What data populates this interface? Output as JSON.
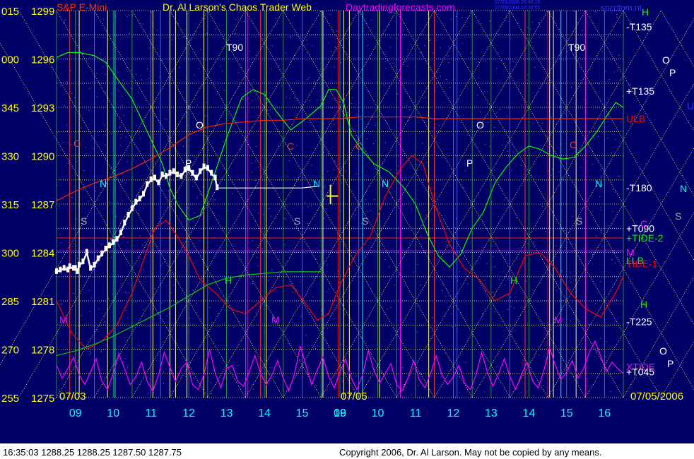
{
  "header": {
    "symbol": "S&P E-Mini",
    "title": "Dr. Al Larson's Chaos Trader Web",
    "site": "Daytradingforecasts.com",
    "stamp1": "07/03/2006 20:40:15",
    "stamp2": "07/05/2006 15:30:05",
    "tag": "spcctom.nt"
  },
  "footer": {
    "quote": "16:35:03  1288.25 1288.25 1287.50 1287.75",
    "copyright": "Copyright 2006, Dr. Al Larson. May not be copied by any means."
  },
  "colors": {
    "background": "#000066",
    "price": "#ffffff",
    "green_line": "#00ff00",
    "red_line": "#ff0000",
    "magenta_line": "#ff00ff",
    "tide_line": "#ff3300",
    "grid": "#ffff66",
    "title": "#ffff00",
    "site": "#ff00ff"
  },
  "chart_data": {
    "type": "line",
    "title": "S&P E-Mini",
    "xlabel": "",
    "ylabel": "",
    "ylim": [
      1275,
      1299
    ],
    "y_ticks": [
      {
        "value": 1299,
        "label": "1299",
        "angle": "015"
      },
      {
        "value": 1296,
        "label": "1296",
        "angle": "000"
      },
      {
        "value": 1293,
        "label": "1293",
        "angle": "345"
      },
      {
        "value": 1290,
        "label": "1290",
        "angle": "330"
      },
      {
        "value": 1287,
        "label": "1287",
        "angle": "315"
      },
      {
        "value": 1284,
        "label": "1284",
        "angle": "300"
      },
      {
        "value": 1281,
        "label": "1281",
        "angle": "285"
      },
      {
        "value": 1278,
        "label": "1278",
        "angle": "270"
      },
      {
        "value": 1275,
        "label": "1275",
        "angle": "255"
      }
    ],
    "x_ticks": [
      "09",
      "10",
      "11",
      "12",
      "13",
      "14",
      "15",
      "16",
      "09",
      "10",
      "11",
      "12",
      "13",
      "14",
      "15",
      "16"
    ],
    "date_labels": [
      "07/03",
      "07/05",
      "07/05/2006"
    ],
    "right_labels": [
      {
        "text": "-T135",
        "value": 1298.0,
        "color": "#ffffff"
      },
      {
        "text": "+T135",
        "value": 1294.0,
        "color": "#ffffff"
      },
      {
        "text": "ULB",
        "value": 1292.3,
        "color": "#ff0000"
      },
      {
        "text": "-T180",
        "value": 1288.0,
        "color": "#ffffff"
      },
      {
        "text": "+T090",
        "value": 1285.5,
        "color": "#ffffff"
      },
      {
        "text": "+TIDE-2",
        "value": 1284.9,
        "color": "#00ff00"
      },
      {
        "text": "M",
        "value": 1284.0,
        "color": "#ff00ff"
      },
      {
        "text": "LLB",
        "value": 1283.5,
        "color": "#00ff00"
      },
      {
        "text": "TIDE-1",
        "value": 1283.3,
        "color": "#ff0000"
      },
      {
        "text": "-T225",
        "value": 1279.7,
        "color": "#ffffff"
      },
      {
        "text": "XTIDE",
        "value": 1276.9,
        "color": "#ff00ff"
      },
      {
        "text": "+T045",
        "value": 1276.6,
        "color": "#ffffff"
      }
    ],
    "planet_labels": [
      {
        "text": "H",
        "x": 908,
        "y": 22,
        "color": "#00ff00"
      },
      {
        "text": "O",
        "x": 937,
        "y": 90,
        "color": "#ffffff"
      },
      {
        "text": "P",
        "x": 947,
        "y": 108,
        "color": "#ffffff"
      },
      {
        "text": "U",
        "x": 972,
        "y": 155,
        "color": "#3333ff"
      },
      {
        "text": "N",
        "x": 962,
        "y": 272,
        "color": "#00ffff"
      },
      {
        "text": "S",
        "x": 955,
        "y": 311,
        "color": "#aaaaaa"
      },
      {
        "text": "C",
        "x": 906,
        "y": 322,
        "color": "#ff00ff"
      },
      {
        "text": "H",
        "x": 906,
        "y": 436,
        "color": "#00ff00"
      },
      {
        "text": "O",
        "x": 933,
        "y": 502,
        "color": "#ffffff"
      },
      {
        "text": "P",
        "x": 944,
        "y": 520,
        "color": "#ffffff"
      },
      {
        "text": "T90",
        "x": 320,
        "y": 72,
        "color": "#ffffff"
      },
      {
        "text": "T90",
        "x": 804,
        "y": 72,
        "color": "#ffffff"
      },
      {
        "text": "O",
        "x": 277,
        "y": 182,
        "color": "#ffffff"
      },
      {
        "text": "O",
        "x": 674,
        "y": 182,
        "color": "#ffffff"
      },
      {
        "text": "P",
        "x": 262,
        "y": 236,
        "color": "#ffffff"
      },
      {
        "text": "P",
        "x": 660,
        "y": 236,
        "color": "#ffffff"
      },
      {
        "text": "N",
        "x": 141,
        "y": 265,
        "color": "#00ffff"
      },
      {
        "text": "N",
        "x": 443,
        "y": 265,
        "color": "#00ffff"
      },
      {
        "text": "N",
        "x": 540,
        "y": 265,
        "color": "#00ffff"
      },
      {
        "text": "N",
        "x": 842,
        "y": 265,
        "color": "#00ffff"
      },
      {
        "text": "C",
        "x": 104,
        "y": 208,
        "color": "#ff3300"
      },
      {
        "text": "C",
        "x": 406,
        "y": 212,
        "color": "#ff3300"
      },
      {
        "text": "C",
        "x": 503,
        "y": 212,
        "color": "#ff3300"
      },
      {
        "text": "C",
        "x": 806,
        "y": 210,
        "color": "#ff3300"
      },
      {
        "text": "H",
        "x": 318,
        "y": 402,
        "color": "#00ff00"
      },
      {
        "text": "H",
        "x": 722,
        "y": 402,
        "color": "#00ff00"
      },
      {
        "text": "M",
        "x": 384,
        "y": 458,
        "color": "#ff00ff"
      },
      {
        "text": "M",
        "x": 784,
        "y": 458,
        "color": "#ff00ff"
      },
      {
        "text": "M",
        "x": 84,
        "y": 458,
        "color": "#ff00ff"
      },
      {
        "text": "S",
        "x": 114,
        "y": 318,
        "color": "#aaaaaa"
      },
      {
        "text": "S",
        "x": 416,
        "y": 318,
        "color": "#aaaaaa"
      },
      {
        "text": "S",
        "x": 512,
        "y": 318,
        "color": "#aaaaaa"
      },
      {
        "text": "S",
        "x": 815,
        "y": 318,
        "color": "#aaaaaa"
      }
    ],
    "series": [
      {
        "name": "S&P E-Mini",
        "color": "#ffffff",
        "x": [
          0.0,
          0.1,
          0.2,
          0.3,
          0.35,
          0.45,
          0.5,
          0.55,
          0.6,
          0.7,
          0.8,
          0.9,
          1.0,
          1.1,
          1.2,
          1.3,
          1.4,
          1.5,
          1.6,
          1.7,
          1.8,
          1.9,
          2.0,
          2.1,
          2.2,
          2.3,
          2.4,
          2.5,
          2.6,
          2.7,
          2.8,
          2.9,
          3.0,
          3.1,
          3.2,
          3.3,
          3.4,
          3.5,
          3.6,
          3.7,
          3.8,
          3.9,
          4.0,
          4.1,
          4.2,
          4.25
        ],
        "values": [
          1282.8,
          1282.9,
          1283.0,
          1282.9,
          1283.1,
          1283.0,
          1283.0,
          1282.8,
          1283.2,
          1283.4,
          1284.0,
          1283.0,
          1283.2,
          1283.6,
          1283.9,
          1284.2,
          1284.4,
          1284.6,
          1284.8,
          1285.2,
          1285.8,
          1286.3,
          1286.7,
          1287.1,
          1287.3,
          1287.6,
          1288.2,
          1288.5,
          1288.6,
          1288.3,
          1288.8,
          1288.7,
          1288.9,
          1289.0,
          1288.8,
          1288.7,
          1289.1,
          1289.2,
          1288.9,
          1288.6,
          1289.0,
          1289.3,
          1289.2,
          1288.9,
          1288.6,
          1288.0
        ]
      },
      {
        "name": "Flat",
        "color": "#ffffff",
        "x": [
          4.25,
          4.5,
          5.0,
          5.5,
          6.0,
          6.5,
          6.9
        ],
        "values": [
          1288.0,
          1288.0,
          1288.0,
          1288.0,
          1288.0,
          1288.0,
          1288.1
        ]
      },
      {
        "name": "Green",
        "color": "#00ff00",
        "x": [
          0,
          0.3,
          0.6,
          1.0,
          1.3,
          1.6,
          2.0,
          2.4,
          2.8,
          3.0,
          3.2,
          3.5,
          3.8,
          4.1,
          4.5,
          4.9,
          5.2,
          5.5,
          5.8,
          6.2,
          6.6,
          7.0,
          7.2,
          7.4,
          7.6,
          7.8,
          8.1,
          8.4,
          8.8,
          9.2,
          9.5,
          9.8,
          10.1,
          10.4,
          10.7,
          11.0,
          11.3,
          11.6,
          11.9,
          12.2,
          12.5,
          12.8,
          13.1,
          13.4,
          13.7,
          14.0,
          14.3,
          14.6,
          14.8,
          15.0
        ],
        "values": [
          1296.1,
          1296.4,
          1296.4,
          1296.2,
          1295.8,
          1294.8,
          1293.5,
          1291.5,
          1289.5,
          1288.0,
          1287.0,
          1286.0,
          1286.3,
          1288.3,
          1291.1,
          1293.6,
          1294.1,
          1293.8,
          1292.8,
          1291.6,
          1292.3,
          1293.1,
          1294.1,
          1294.1,
          1293.3,
          1291.3,
          1290.3,
          1289.5,
          1289.0,
          1288.0,
          1287.0,
          1285.2,
          1283.8,
          1283.1,
          1283.9,
          1285.5,
          1286.5,
          1288.3,
          1289.3,
          1290.1,
          1290.6,
          1290.4,
          1290.0,
          1289.8,
          1289.9,
          1290.6,
          1291.5,
          1292.6,
          1293.3,
          1293.0
        ]
      },
      {
        "name": "Red",
        "color": "#ff0000",
        "x": [
          0,
          0.4,
          0.8,
          1.2,
          1.6,
          2.0,
          2.3,
          2.6,
          2.9,
          3.2,
          3.5,
          3.8,
          4.2,
          4.6,
          5.0,
          5.4,
          5.8,
          6.2,
          6.6,
          6.9,
          7.2,
          7.5,
          7.9,
          8.3,
          8.7,
          9.1,
          9.4,
          9.7,
          10.0,
          10.4,
          10.8,
          11.2,
          11.6,
          12.0,
          12.4,
          12.8,
          13.2,
          13.6,
          14.0,
          14.4,
          14.8,
          15.0
        ],
        "values": [
          1281.0,
          1279.0,
          1278.0,
          1278.5,
          1279.5,
          1281.5,
          1283.5,
          1285.5,
          1286.0,
          1285.0,
          1283.8,
          1282.3,
          1281.5,
          1280.5,
          1280.2,
          1281.0,
          1281.8,
          1282.0,
          1280.8,
          1279.8,
          1280.2,
          1282.0,
          1283.8,
          1285.0,
          1287.5,
          1289.2,
          1290.0,
          1289.5,
          1287.0,
          1284.5,
          1283.0,
          1282.3,
          1281.0,
          1281.5,
          1283.8,
          1284.0,
          1283.0,
          1281.5,
          1280.5,
          1280.0,
          1281.5,
          1282.5
        ]
      },
      {
        "name": "ULB",
        "color": "#ff2200",
        "x": [
          0,
          0.5,
          1.0,
          1.5,
          2.0,
          2.5,
          3.0,
          3.5,
          4.0,
          4.5,
          5.0,
          5.5,
          6.0,
          6.5,
          7.0,
          7.5,
          8.0,
          8.5,
          9.0,
          9.5,
          10.0,
          10.5,
          11.0,
          11.5,
          12.0,
          12.5,
          13.0,
          13.5,
          14.0,
          14.5,
          15.0
        ],
        "values": [
          1287.2,
          1287.8,
          1288.3,
          1288.7,
          1289.2,
          1289.8,
          1290.5,
          1291.3,
          1291.8,
          1292.0,
          1292.1,
          1292.2,
          1292.2,
          1292.3,
          1292.3,
          1292.3,
          1292.4,
          1292.4,
          1292.4,
          1292.4,
          1292.3,
          1292.3,
          1292.3,
          1292.3,
          1292.3,
          1292.3,
          1292.3,
          1292.3,
          1292.3,
          1292.3,
          1292.3
        ]
      },
      {
        "name": "LLB",
        "color": "#00cc00",
        "x": [
          0,
          0.5,
          1.0,
          1.5,
          2.0,
          2.5,
          3.0,
          3.5,
          4.0,
          4.5,
          5.0,
          5.5,
          6.0,
          6.5,
          7.0
        ],
        "values": [
          1277.6,
          1277.9,
          1278.3,
          1278.8,
          1279.4,
          1280.0,
          1280.6,
          1281.3,
          1282.0,
          1282.4,
          1282.6,
          1282.7,
          1282.8,
          1282.8,
          1282.8
        ]
      },
      {
        "name": "Magenta",
        "color": "#ff00ff",
        "x": [
          0,
          0.15,
          0.3,
          0.45,
          0.6,
          0.75,
          0.9,
          1.05,
          1.2,
          1.35,
          1.5,
          1.65,
          1.8,
          1.95,
          2.1,
          2.25,
          2.4,
          2.55,
          2.7,
          2.85,
          3.0,
          3.15,
          3.3,
          3.45,
          3.6,
          3.75,
          3.9,
          4.05,
          4.2,
          4.35,
          4.5,
          4.65,
          4.8,
          4.95,
          5.1,
          5.25,
          5.4,
          5.55,
          5.7,
          5.85,
          6.0,
          6.15,
          6.3,
          6.45,
          6.6,
          6.75,
          6.9,
          7.05,
          7.2,
          7.35,
          7.5,
          7.65,
          7.8,
          7.95,
          8.1,
          8.25,
          8.4,
          8.55,
          8.7,
          8.85,
          9.0,
          9.15,
          9.3,
          9.45,
          9.6,
          9.75,
          9.9,
          10.05,
          10.2,
          10.35,
          10.5,
          10.65,
          10.8,
          10.95,
          11.1,
          11.25,
          11.4,
          11.55,
          11.7,
          11.85,
          12.0,
          12.15,
          12.3,
          12.45,
          12.6,
          12.75,
          12.9,
          13.05,
          13.2,
          13.35,
          13.5,
          13.65,
          13.8,
          13.95,
          14.1,
          14.25,
          14.4,
          14.55,
          14.7,
          14.85,
          15.0
        ],
        "values": [
          1277.0,
          1276.2,
          1276.8,
          1277.5,
          1276.4,
          1275.8,
          1276.6,
          1277.4,
          1276.0,
          1275.5,
          1276.5,
          1277.7,
          1276.8,
          1275.8,
          1276.3,
          1277.2,
          1276.0,
          1275.4,
          1276.4,
          1277.8,
          1276.9,
          1276.0,
          1276.8,
          1277.2,
          1275.8,
          1275.5,
          1276.4,
          1278.0,
          1276.5,
          1275.6,
          1276.8,
          1277.0,
          1276.0,
          1275.7,
          1276.6,
          1277.6,
          1276.5,
          1275.8,
          1276.4,
          1277.3,
          1276.2,
          1275.4,
          1276.5,
          1278.2,
          1277.0,
          1275.8,
          1276.7,
          1277.5,
          1276.3,
          1275.6,
          1276.6,
          1277.4,
          1276.2,
          1275.5,
          1276.4,
          1277.9,
          1276.7,
          1275.9,
          1276.5,
          1277.1,
          1275.8,
          1275.4,
          1276.2,
          1277.3,
          1276.1,
          1275.6,
          1276.5,
          1277.6,
          1276.4,
          1275.8,
          1276.3,
          1277.0,
          1275.9,
          1275.5,
          1276.4,
          1277.8,
          1276.6,
          1275.7,
          1276.5,
          1277.4,
          1276.3,
          1275.5,
          1276.4,
          1277.2,
          1276.0,
          1275.6,
          1276.7,
          1278.1,
          1277.0,
          1276.1,
          1276.6,
          1277.3,
          1276.2,
          1276.8,
          1277.8,
          1278.5,
          1277.6,
          1276.6,
          1277.2,
          1276.8,
          1276.5
        ]
      }
    ],
    "grid": true
  }
}
